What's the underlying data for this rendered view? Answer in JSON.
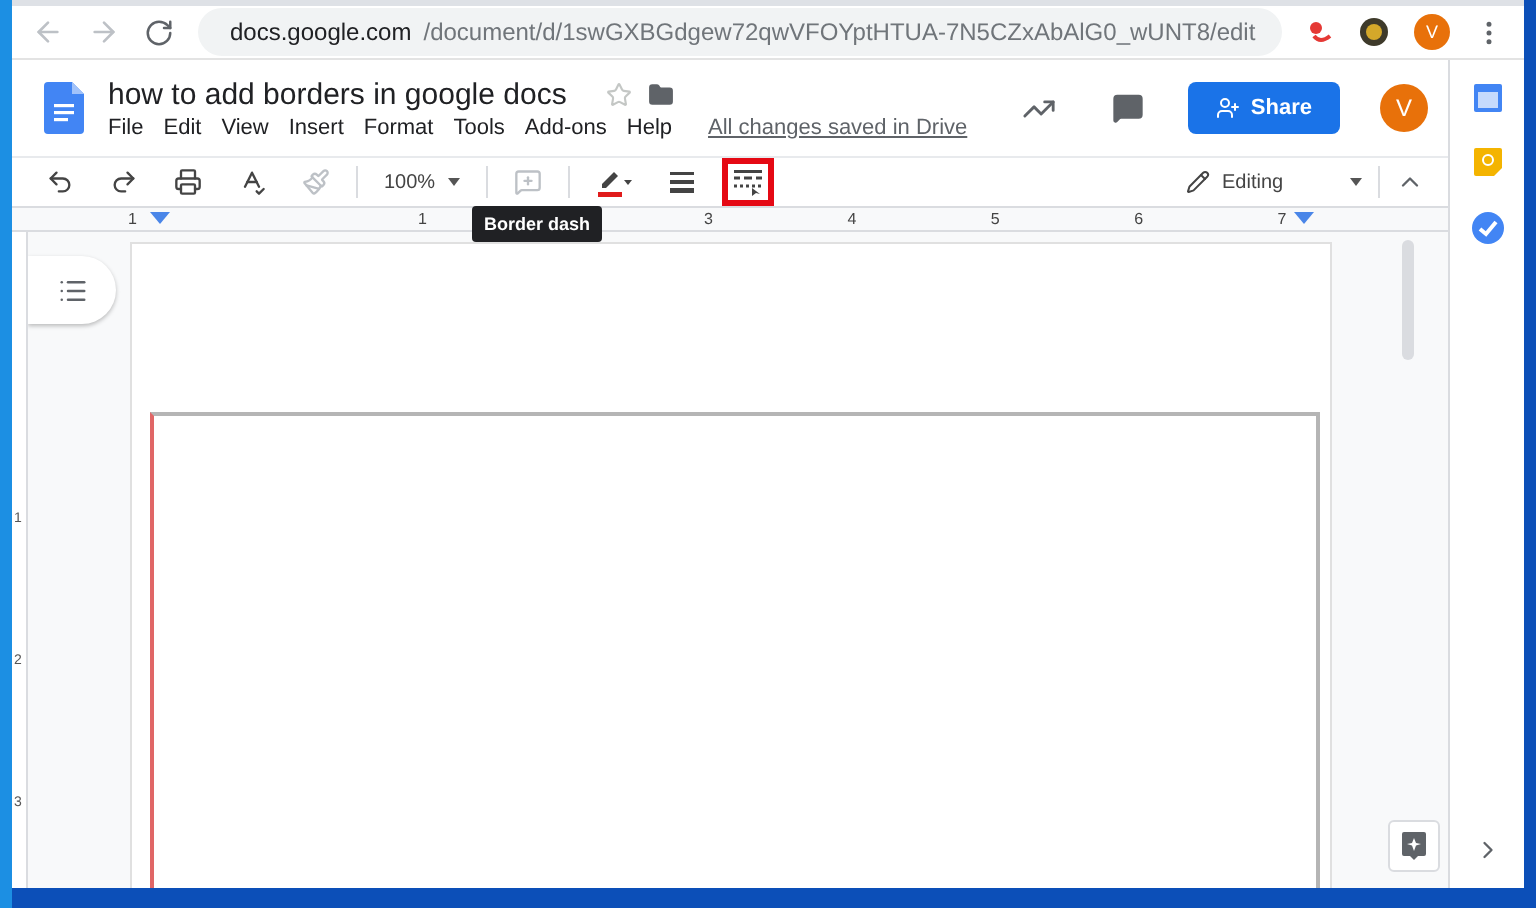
{
  "browser": {
    "url_host": "docs.google.com",
    "url_path": "/document/d/1swGXBGdgew72qwVFOYptHTUA-7N5CZxAbAlG0_wUNT8/edit",
    "profile_initial": "V"
  },
  "doc": {
    "title": "how to add borders in google docs",
    "starred": false
  },
  "menu": [
    "File",
    "Edit",
    "View",
    "Insert",
    "Format",
    "Tools",
    "Add-ons",
    "Help"
  ],
  "save_status": "All changes saved in Drive",
  "share_label": "Share",
  "avatar_initial": "V",
  "toolbar": {
    "zoom": "100%",
    "mode": "Editing",
    "tools": [
      {
        "kind": "undo",
        "disabled": false,
        "selected": false
      },
      {
        "kind": "redo",
        "disabled": false,
        "selected": false
      },
      {
        "kind": "print",
        "disabled": false,
        "selected": false
      },
      {
        "kind": "spellcheck",
        "disabled": false,
        "selected": false
      },
      {
        "kind": "paint",
        "disabled": true,
        "selected": false
      },
      {
        "kind": "zoom",
        "disabled": false,
        "selected": false
      },
      {
        "kind": "comment",
        "disabled": true,
        "selected": false
      },
      {
        "kind": "border-color",
        "disabled": false,
        "selected": false
      },
      {
        "kind": "border-width",
        "disabled": false,
        "selected": false
      },
      {
        "kind": "border-dash",
        "disabled": false,
        "selected": true
      }
    ]
  },
  "tooltip": "Border dash",
  "ruler": {
    "left_labels": [
      "1",
      "1"
    ],
    "right_labels": [
      "3",
      "4",
      "5",
      "6",
      "7"
    ],
    "vertical_labels": [
      "1",
      "2",
      "3"
    ]
  }
}
